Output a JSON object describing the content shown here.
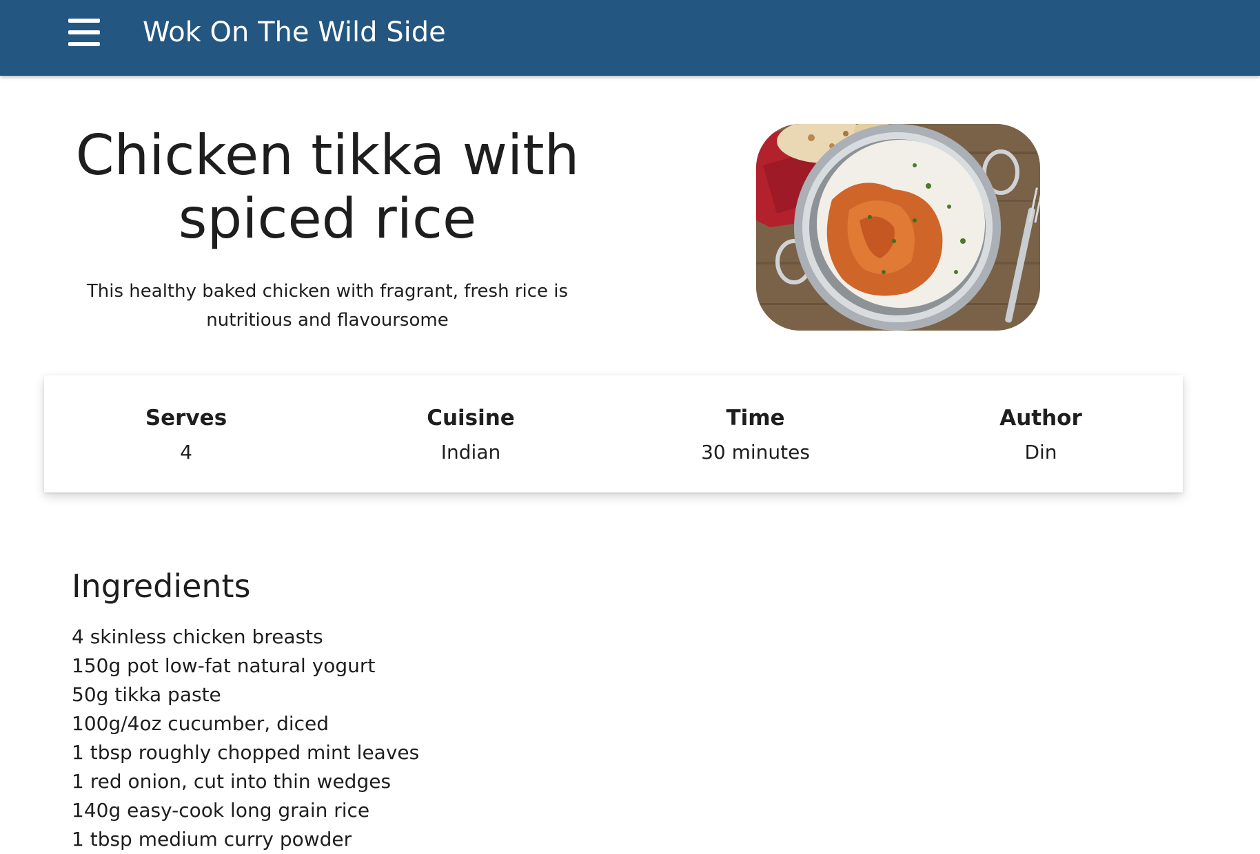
{
  "header": {
    "app_title": "Wok On The Wild Side",
    "menu_icon": "hamburger-menu-icon",
    "background_color": "#235681"
  },
  "recipe": {
    "title": "Chicken tikka with spiced rice",
    "subtitle": "This healthy baked chicken with fragrant, fresh rice is nutritious and flavoursome"
  },
  "info": [
    {
      "label": "Serves",
      "value": "4"
    },
    {
      "label": "Cuisine",
      "value": "Indian"
    },
    {
      "label": "Time",
      "value": "30 minutes"
    },
    {
      "label": "Author",
      "value": "Din"
    }
  ],
  "ingredients": {
    "heading": "Ingredients",
    "items": [
      "4 skinless chicken breasts",
      "150g pot low-fat natural yogurt",
      "50g tikka paste",
      "100g/4oz cucumber, diced",
      "1 tbsp roughly chopped mint leaves",
      "1 red onion, cut into thin wedges",
      "140g easy-cook long grain rice",
      "1 tbsp medium curry powder"
    ]
  }
}
